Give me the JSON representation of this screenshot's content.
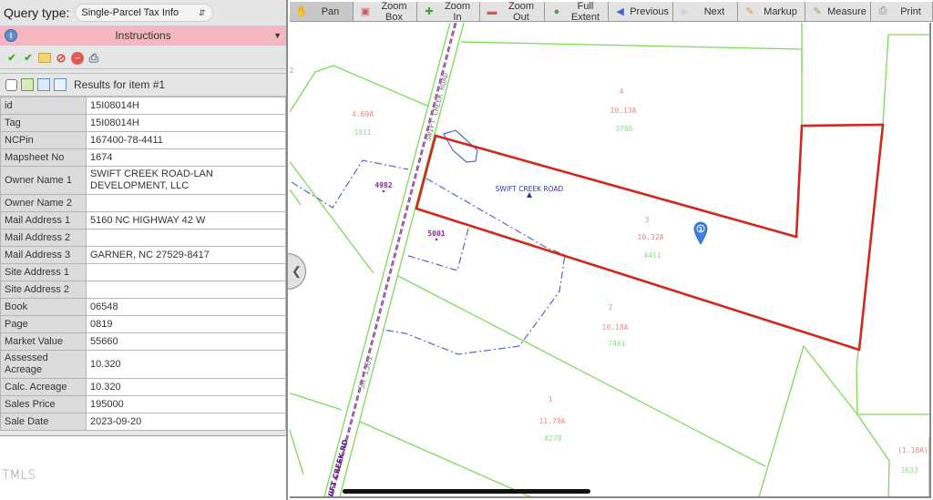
{
  "query": {
    "label": "Query type:",
    "selected": "Single-Parcel Tax Info"
  },
  "instructions": {
    "title": "Instructions",
    "info_icon": "info-icon",
    "chevron": "chevron-down-icon"
  },
  "result_tools": [
    {
      "icon": "check-add-icon"
    },
    {
      "icon": "check-remove-icon"
    },
    {
      "icon": "folder-add-icon"
    },
    {
      "icon": "no-select-icon"
    },
    {
      "icon": "remove-icon"
    },
    {
      "icon": "print-icon"
    }
  ],
  "results": {
    "title": "Results for item #1",
    "icons": [
      "zoom-to-icon",
      "export-icon",
      "windows-icon"
    ]
  },
  "attributes": [
    {
      "key": "id",
      "value": "15I08014H"
    },
    {
      "key": "Tag",
      "value": "15I08014H"
    },
    {
      "key": "NCPin",
      "value": "167400-78-4411"
    },
    {
      "key": "Mapsheet No",
      "value": "1674"
    },
    {
      "key": "Owner Name 1",
      "value": "SWIFT CREEK ROAD-LAN DEVELOPMENT, LLC"
    },
    {
      "key": "Owner Name 2",
      "value": ""
    },
    {
      "key": "Mail Address 1",
      "value": "5160 NC HIGHWAY 42 W"
    },
    {
      "key": "Mail Address 2",
      "value": ""
    },
    {
      "key": "Mail Address 3",
      "value": "GARNER, NC 27529-8417"
    },
    {
      "key": "Site Address 1",
      "value": ""
    },
    {
      "key": "Site Address 2",
      "value": ""
    },
    {
      "key": "Book",
      "value": "06548"
    },
    {
      "key": "Page",
      "value": "0819"
    },
    {
      "key": "Market Value",
      "value": "55660"
    },
    {
      "key": "Assessed Acreage",
      "value": "10.320"
    },
    {
      "key": "Calc. Acreage",
      "value": "10.320"
    },
    {
      "key": "Sales Price",
      "value": "195000"
    },
    {
      "key": "Sale Date",
      "value": "2023-09-20"
    }
  ],
  "watermark": "TMLS",
  "toolbar": [
    {
      "label": "Pan",
      "icon": "hand-icon",
      "active": true
    },
    {
      "label": "Zoom Box",
      "icon": "zoom-box-icon"
    },
    {
      "label": "Zoom In",
      "icon": "zoom-in-icon"
    },
    {
      "label": "Zoom Out",
      "icon": "zoom-out-icon"
    },
    {
      "label": "Full Extent",
      "icon": "globe-icon"
    },
    {
      "label": "Previous",
      "icon": "arrow-left-icon"
    },
    {
      "label": "Next",
      "icon": "arrow-right-icon",
      "disabled": true
    },
    {
      "label": "Markup",
      "icon": "pencil-icon"
    },
    {
      "label": "Measure",
      "icon": "ruler-icon"
    },
    {
      "label": "Print",
      "icon": "printer-icon"
    }
  ],
  "map": {
    "colors": {
      "parcel_line": "#7ed957",
      "selected_parcel": "#d0281c",
      "easement": "#5566c8",
      "road_center": "#6a1f8a",
      "acreage_text": "#e08a8a",
      "pin_text": "#8fdc8f",
      "label_blue": "#2a3a9a",
      "address_text": "#8a2a9a",
      "marker": "#3f7fe0"
    },
    "road_labels": [
      "SWIFT CREEK ROAD",
      "SR 1501",
      "SWIFT CREEK RD"
    ],
    "poi_label": "SWIFT CREEK ROAD",
    "marker_label": "1",
    "addresses": [
      "4982",
      "5001"
    ],
    "parcels": [
      {
        "lot": "2",
        "acreage": "",
        "pin": ""
      },
      {
        "lot": "",
        "acreage": "4.69A",
        "pin": "1011"
      },
      {
        "lot": "4",
        "acreage": "10.13A",
        "pin": "3786"
      },
      {
        "lot": "3",
        "acreage": "10.32A",
        "pin": "4411"
      },
      {
        "lot": "2",
        "acreage": "10.18A",
        "pin": "7461"
      },
      {
        "lot": "1",
        "acreage": "11.79A",
        "pin": "8278"
      },
      {
        "lot": "",
        "acreage": "(1.18A)",
        "pin": "1633"
      }
    ]
  }
}
